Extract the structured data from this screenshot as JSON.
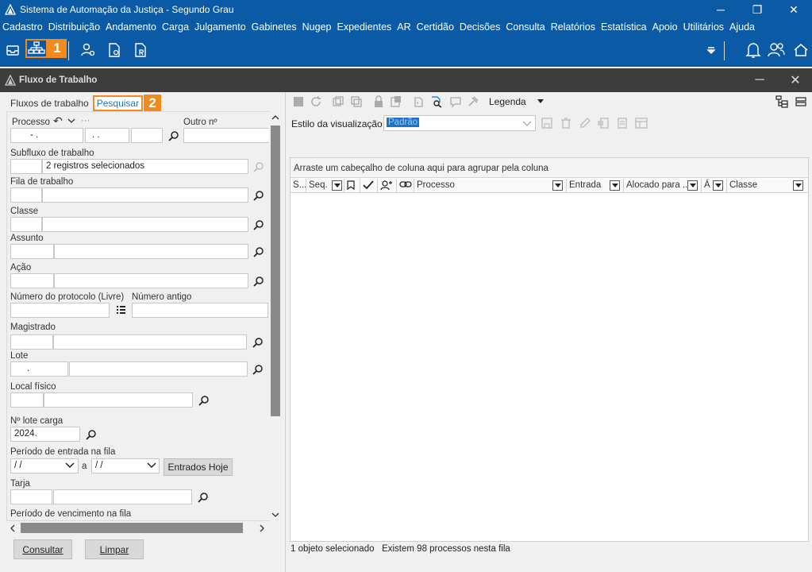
{
  "window": {
    "title": "Sistema de Automação da Justiça - Segundo Grau",
    "minimize": "─",
    "restore": "❐",
    "close": "✕"
  },
  "menu": [
    "Cadastro",
    "Distribuição",
    "Andamento",
    "Carga",
    "Julgamento",
    "Gabinetes",
    "Nugep",
    "Expedientes",
    "AR",
    "Certidão",
    "Decisões",
    "Consulta",
    "Relatórios",
    "Estatística",
    "Apoio",
    "Utilitários",
    "Ajuda"
  ],
  "toolbar": {
    "badge1": "1",
    "colors": {
      "accent": "#f28b1e",
      "bar": "#0b5aa6"
    }
  },
  "inner_window": {
    "title": "Fluxo de Trabalho",
    "minimize": "─",
    "close": "✕"
  },
  "left": {
    "tabs": {
      "fluxos": "Fluxos de trabalho",
      "pesquisar": "Pesquisar",
      "badge2": "2"
    },
    "processo": {
      "label": "Processo",
      "undo": "↶",
      "more": "···",
      "value1": "- .",
      "value2": ". .",
      "outro_label": "Outro nº"
    },
    "subfluxo": {
      "label": "Subfluxo de trabalho",
      "value": "2 registros selecionados"
    },
    "fila": {
      "label": "Fila de trabalho"
    },
    "classe": {
      "label": "Classe"
    },
    "assunto": {
      "label": "Assunto"
    },
    "acao": {
      "label": "Ação"
    },
    "protocolo": {
      "label": "Número do protocolo (Livre)",
      "antigo_label": "Número antigo"
    },
    "magistrado": {
      "label": "Magistrado"
    },
    "lote": {
      "label": "Lote",
      "value": "."
    },
    "local": {
      "label": "Local físico"
    },
    "lote_carga": {
      "label": "Nº lote carga",
      "value": "2024."
    },
    "periodo_entrada": {
      "label": "Período de entrada na fila",
      "from": " / /",
      "sep": "a",
      "to": " / /",
      "button": "Entrados Hoje"
    },
    "tarja": {
      "label": "Tarja"
    },
    "periodo_venc": {
      "label": "Período de vencimento na fila"
    },
    "buttons": {
      "consultar": "Consultar",
      "limpar": "Limpar"
    }
  },
  "right": {
    "legenda": "Legenda",
    "estilo_label": "Estilo da visualização",
    "estilo_value": "Padrão",
    "group_hint": "Arraste um cabeçalho de coluna aqui para agrupar pela coluna",
    "columns": {
      "s": "S...",
      "seq": "Seq.",
      "processo": "Processo",
      "entrada": "Entrada",
      "alocado": "Alocado para ...",
      "a": "Á",
      "classe": "Classe"
    },
    "status": "1 objeto selecionado   Existem 98 processos nesta fila"
  }
}
